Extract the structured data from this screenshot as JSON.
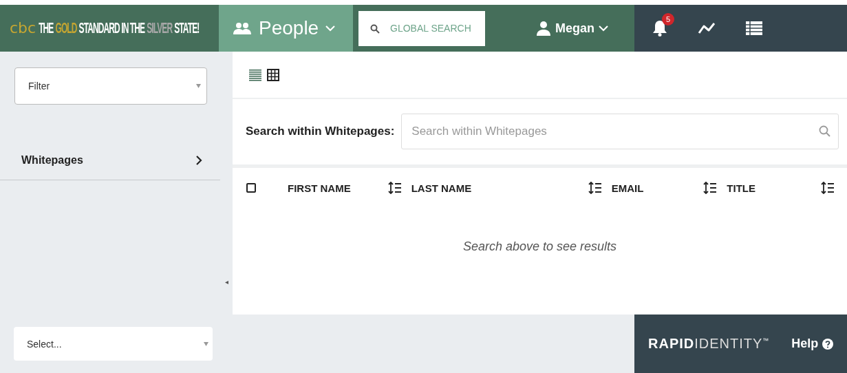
{
  "header": {
    "logo_text": "cbc",
    "tagline": [
      {
        "text": "THE",
        "kind": "plain"
      },
      {
        "text": "GOLD",
        "kind": "gold"
      },
      {
        "text": "STANDARD IN THE",
        "kind": "plain"
      },
      {
        "text": "SILVER",
        "kind": "silver"
      },
      {
        "text": "STATE!",
        "kind": "plain"
      }
    ],
    "module": {
      "label": "People"
    },
    "global_search": {
      "placeholder": "GLOBAL SEARCH"
    },
    "user": {
      "name": "Megan"
    },
    "notifications": {
      "count": "5"
    }
  },
  "sidebar": {
    "filter": {
      "placeholder": "Filter"
    },
    "items": [
      {
        "label": "Whitepages",
        "selected": false
      }
    ],
    "collapse_glyph": "◂"
  },
  "main": {
    "views": [
      {
        "kind": "list",
        "selected": true
      },
      {
        "kind": "grid",
        "selected": false
      }
    ],
    "search": {
      "label": "Search within Whitepages:",
      "placeholder": "Search within Whitepages"
    },
    "table": {
      "select_all": {
        "checked": false
      },
      "columns": [
        {
          "label": "FIRST NAME"
        },
        {
          "label": "LAST NAME"
        },
        {
          "label": "EMAIL"
        },
        {
          "label": "TITLE"
        }
      ],
      "empty_message": "Search above to see results"
    }
  },
  "footer": {
    "select": {
      "placeholder": "Select..."
    },
    "brand": {
      "bold": "RAPID",
      "light": "IDENTITY",
      "mark": "™"
    },
    "help": {
      "label": "Help"
    }
  }
}
